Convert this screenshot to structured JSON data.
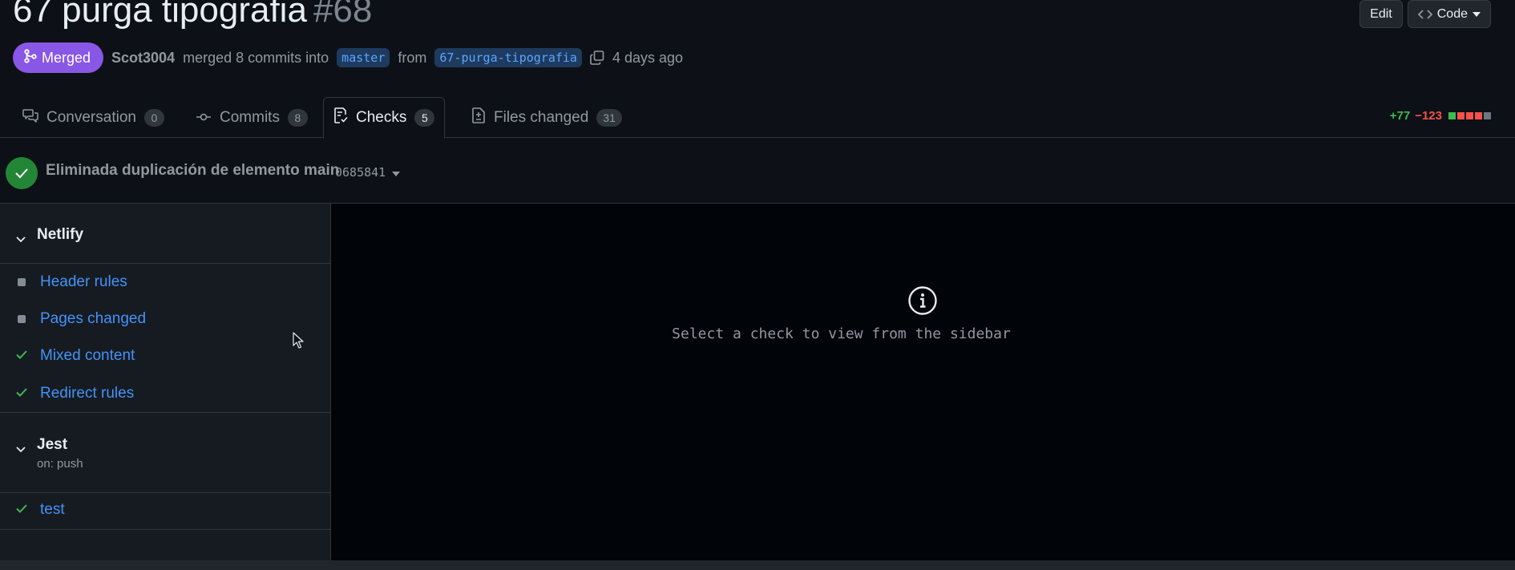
{
  "pr": {
    "title": "67 purga tipografia",
    "number": "#68",
    "status": "Merged",
    "author": "Scot3004",
    "merge_text": "merged 8 commits into",
    "base_branch": "master",
    "from_text": "from",
    "head_branch": "67-purga-tipografia",
    "time": "4 days ago"
  },
  "header_actions": {
    "edit_label": "Edit",
    "code_label": "Code"
  },
  "tabs": [
    {
      "label": "Conversation",
      "count": "0",
      "icon": "comment-discussion-icon"
    },
    {
      "label": "Commits",
      "count": "8",
      "icon": "git-commit-icon"
    },
    {
      "label": "Checks",
      "count": "5",
      "icon": "checklist-icon",
      "active": true
    },
    {
      "label": "Files changed",
      "count": "31",
      "icon": "file-diff-icon"
    }
  ],
  "diffstat": {
    "additions": "+77",
    "deletions": "−123",
    "blocks": [
      "green",
      "red",
      "red",
      "red",
      "grey"
    ]
  },
  "commit": {
    "message": "Eliminada duplicación de elemento main",
    "sha": "0685841",
    "status": "success"
  },
  "sidebar": {
    "groups": [
      {
        "name": "Netlify",
        "checks": [
          {
            "label": "Header rules",
            "status": "neutral"
          },
          {
            "label": "Pages changed",
            "status": "neutral"
          },
          {
            "label": "Mixed content",
            "status": "success"
          },
          {
            "label": "Redirect rules",
            "status": "success"
          }
        ]
      },
      {
        "name": "Jest",
        "trigger": "on: push",
        "checks": [
          {
            "label": "test",
            "status": "success"
          }
        ]
      }
    ]
  },
  "main": {
    "empty_message": "Select a check to view from the sidebar",
    "icon": "info-icon"
  },
  "colors": {
    "merged": "#8957e5",
    "success": "#3fb950",
    "link": "#4493f8",
    "background": "#0d1117"
  }
}
